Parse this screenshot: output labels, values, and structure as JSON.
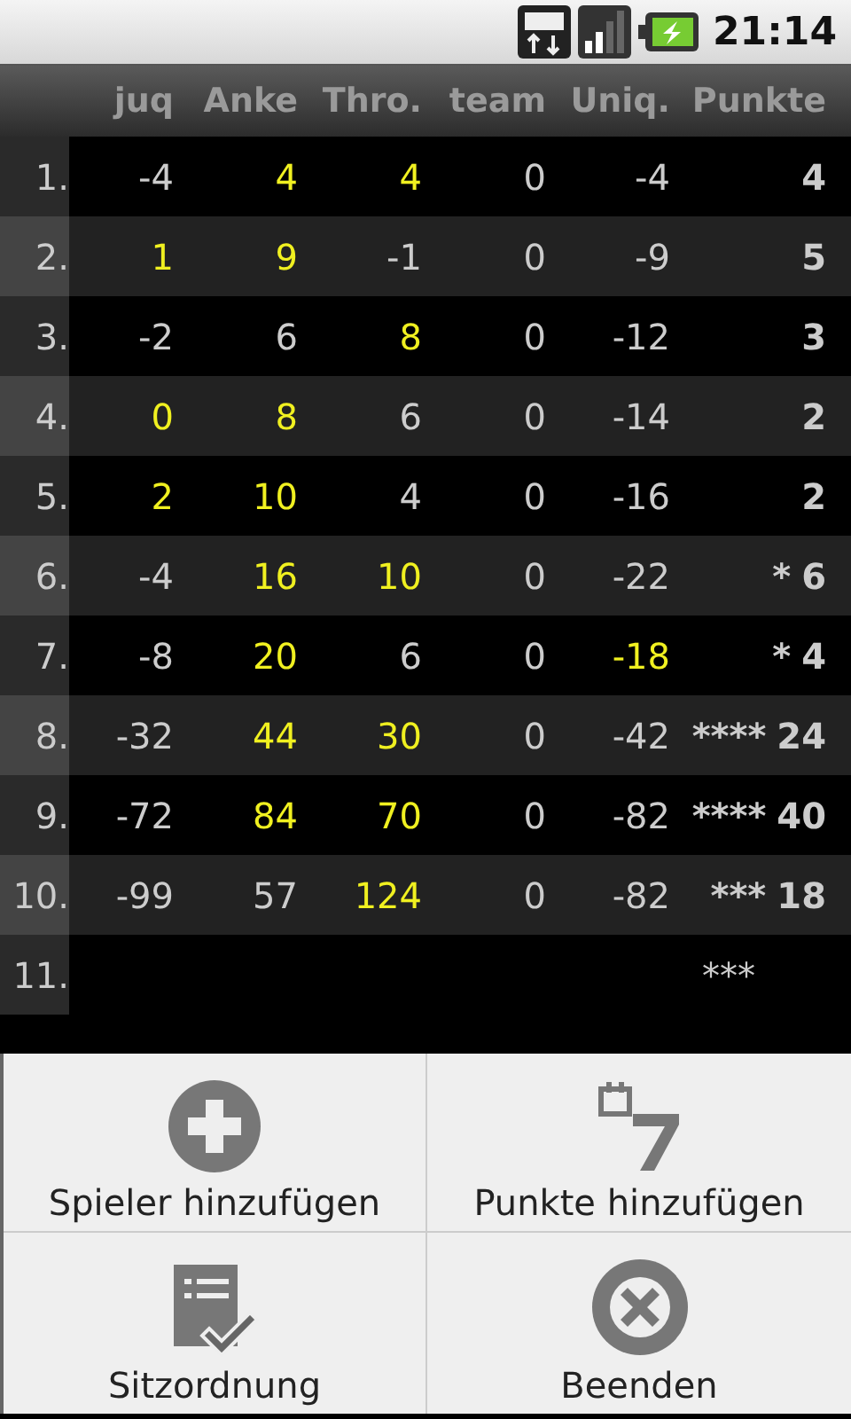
{
  "status_bar": {
    "time": "21:14"
  },
  "table": {
    "columns": [
      "juq",
      "Anke",
      "Thro.",
      "team",
      "Uniq.",
      "Punkte"
    ],
    "rows": [
      {
        "number": "1.",
        "cells": [
          {
            "text": "-4",
            "highlight": false
          },
          {
            "text": "4",
            "highlight": true
          },
          {
            "text": "4",
            "highlight": true
          },
          {
            "text": "0",
            "highlight": false
          },
          {
            "text": "-4",
            "highlight": false
          }
        ],
        "points": "4"
      },
      {
        "number": "2.",
        "cells": [
          {
            "text": "1",
            "highlight": true
          },
          {
            "text": "9",
            "highlight": true
          },
          {
            "text": "-1",
            "highlight": false
          },
          {
            "text": "0",
            "highlight": false
          },
          {
            "text": "-9",
            "highlight": false
          }
        ],
        "points": "5"
      },
      {
        "number": "3.",
        "cells": [
          {
            "text": "-2",
            "highlight": false
          },
          {
            "text": "6",
            "highlight": false
          },
          {
            "text": "8",
            "highlight": true
          },
          {
            "text": "0",
            "highlight": false
          },
          {
            "text": "-12",
            "highlight": false
          }
        ],
        "points": "3"
      },
      {
        "number": "4.",
        "cells": [
          {
            "text": "0",
            "highlight": true
          },
          {
            "text": "8",
            "highlight": true
          },
          {
            "text": "6",
            "highlight": false
          },
          {
            "text": "0",
            "highlight": false
          },
          {
            "text": "-14",
            "highlight": false
          }
        ],
        "points": "2"
      },
      {
        "number": "5.",
        "cells": [
          {
            "text": "2",
            "highlight": true
          },
          {
            "text": "10",
            "highlight": true
          },
          {
            "text": "4",
            "highlight": false
          },
          {
            "text": "0",
            "highlight": false
          },
          {
            "text": "-16",
            "highlight": false
          }
        ],
        "points": "2"
      },
      {
        "number": "6.",
        "cells": [
          {
            "text": "-4",
            "highlight": false
          },
          {
            "text": "16",
            "highlight": true
          },
          {
            "text": "10",
            "highlight": true
          },
          {
            "text": "0",
            "highlight": false
          },
          {
            "text": "-22",
            "highlight": false
          }
        ],
        "marks": "*",
        "points": "6"
      },
      {
        "number": "7.",
        "cells": [
          {
            "text": "-8",
            "highlight": false
          },
          {
            "text": "20",
            "highlight": true
          },
          {
            "text": "6",
            "highlight": false
          },
          {
            "text": "0",
            "highlight": false
          },
          {
            "text": "-18",
            "highlight": true
          }
        ],
        "marks": "*",
        "points": "4"
      },
      {
        "number": "8.",
        "cells": [
          {
            "text": "-32",
            "highlight": false
          },
          {
            "text": "44",
            "highlight": true
          },
          {
            "text": "30",
            "highlight": true
          },
          {
            "text": "0",
            "highlight": false
          },
          {
            "text": "-42",
            "highlight": false
          }
        ],
        "marks": "****",
        "points": "24"
      },
      {
        "number": "9.",
        "cells": [
          {
            "text": "-72",
            "highlight": false
          },
          {
            "text": "84",
            "highlight": true
          },
          {
            "text": "70",
            "highlight": true
          },
          {
            "text": "0",
            "highlight": false
          },
          {
            "text": "-82",
            "highlight": false
          }
        ],
        "marks": "****",
        "points": "40"
      },
      {
        "number": "10.",
        "cells": [
          {
            "text": "-99",
            "highlight": false
          },
          {
            "text": "57",
            "highlight": false
          },
          {
            "text": "124",
            "highlight": true
          },
          {
            "text": "0",
            "highlight": false
          },
          {
            "text": "-82",
            "highlight": false
          }
        ],
        "marks": "***",
        "points": "18"
      },
      {
        "number": "11.",
        "marks": "***"
      }
    ]
  },
  "menu": [
    {
      "label": "Spieler hinzufügen",
      "kind": "add"
    },
    {
      "label": "Punkte hinzufügen",
      "kind": "calendar"
    },
    {
      "label": "Sitzordnung",
      "kind": "checklist"
    },
    {
      "label": "Beenden",
      "kind": "close"
    }
  ]
}
